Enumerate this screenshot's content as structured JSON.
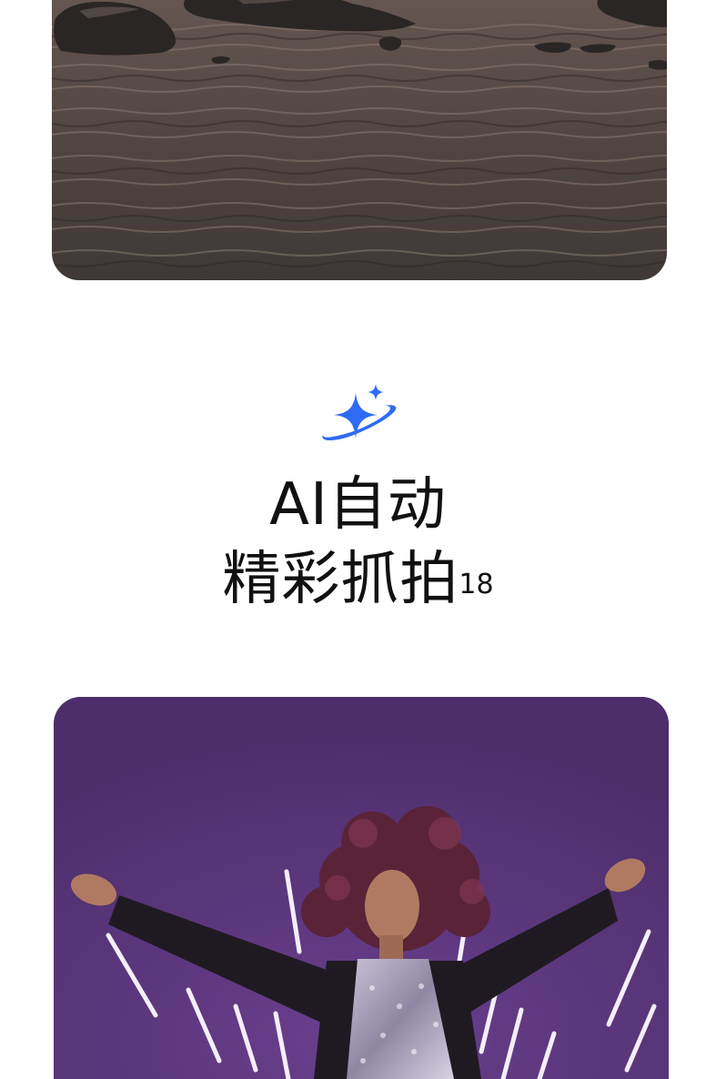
{
  "feature": {
    "icon": "ai-sparkle-icon",
    "title_line_1": "AI自动",
    "title_line_2": "精彩抓拍",
    "footnote": "18",
    "accent_color": "#2f6bf2"
  },
  "photos": {
    "top": "sea-rocks-dusk-photo",
    "bottom": "dancer-purple-photo"
  }
}
